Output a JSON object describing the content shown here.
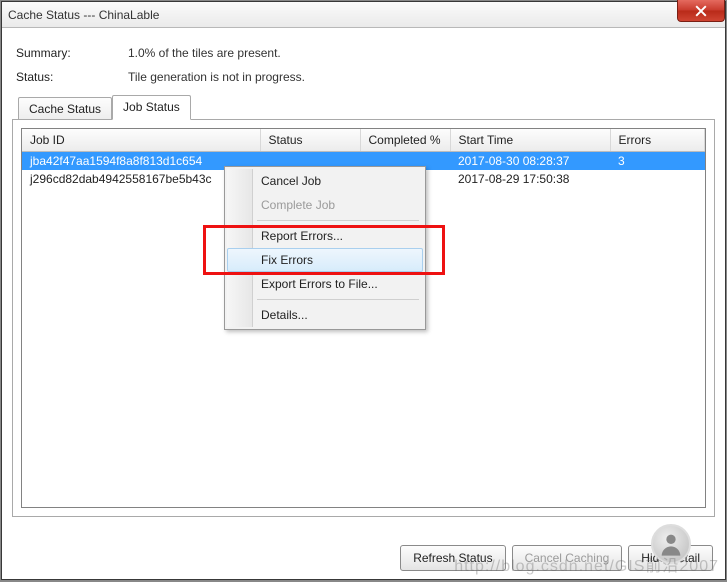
{
  "window": {
    "title": "Cache Status --- ChinaLable"
  },
  "summary": {
    "label": "Summary:",
    "value": "1.0% of the tiles are present."
  },
  "status": {
    "label": "Status:",
    "value": "Tile generation is not in progress."
  },
  "tabs": {
    "cache_status": "Cache Status",
    "job_status": "Job Status"
  },
  "table": {
    "headers": {
      "job_id": "Job ID",
      "status": "Status",
      "completed": "Completed %",
      "start_time": "Start Time",
      "errors": "Errors"
    },
    "rows": [
      {
        "job_id": "jba42f47aa1594f8a8f813d1c654",
        "status": "",
        "completed": "",
        "start_time": "2017-08-30 08:28:37",
        "errors": "3",
        "selected": true
      },
      {
        "job_id": "j296cd82dab4942558167be5b43c",
        "status": "",
        "completed": "",
        "start_time": "2017-08-29 17:50:38",
        "errors": "",
        "selected": false
      }
    ]
  },
  "context_menu": {
    "cancel": "Cancel Job",
    "complete": "Complete Job",
    "report": "Report Errors...",
    "fix": "Fix Errors",
    "export": "Export Errors to File...",
    "details": "Details..."
  },
  "buttons": {
    "refresh": "Refresh Status",
    "cancel_caching": "Cancel Caching",
    "hide_details": "Hide Detail"
  },
  "watermark": "http://blog.csdn.net/GIS前沿2007"
}
